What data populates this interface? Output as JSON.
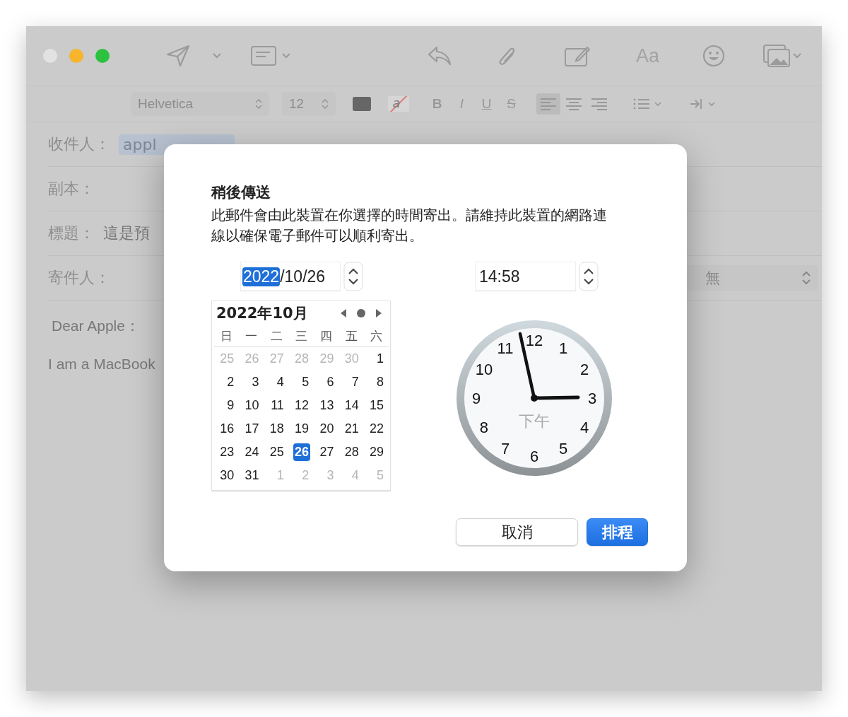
{
  "window": {
    "controls": [
      {
        "color": "#e2e2e2"
      },
      {
        "color": "#f7b52c"
      },
      {
        "color": "#2cc23f"
      }
    ]
  },
  "toolbar": {
    "font_button": "Aa"
  },
  "format_bar": {
    "font": "Helvetica",
    "size": "12",
    "strike_sample": "a",
    "styles": [
      {
        "text": "B",
        "kind": "bold"
      },
      {
        "text": "I",
        "kind": "italic"
      },
      {
        "text": "U",
        "kind": "underline"
      },
      {
        "text": "S",
        "kind": "strike"
      }
    ],
    "align_buttons": [
      {
        "kind": "left",
        "selected": true
      },
      {
        "kind": "center",
        "selected": false
      },
      {
        "kind": "right",
        "selected": false
      }
    ]
  },
  "header_fields": [
    {
      "label": "收件人：",
      "kind": "token",
      "value": "appl"
    },
    {
      "label": "副本：",
      "kind": "text"
    },
    {
      "label": "標題：",
      "kind": "text",
      "value": "這是預"
    },
    {
      "label": "寄件人：",
      "kind": "sender",
      "popup_value": "無"
    }
  ],
  "body": {
    "lines": [
      "Dear Apple：",
      "I am a MacBook"
    ]
  },
  "dialog": {
    "title": "稍後傳送",
    "message": "此郵件會由此裝置在你選擇的時間寄出。請維持此裝置的網路連線以確保電子郵件可以順利寄出。",
    "date_segments": [
      {
        "text": "2022",
        "selected": true
      },
      {
        "text": "/10/26",
        "selected": false
      }
    ],
    "time": "14:58",
    "calendar": {
      "title": "2022年10月",
      "weekdays": [
        "日",
        "一",
        "二",
        "三",
        "四",
        "五",
        "六"
      ],
      "weeks": [
        [
          {
            "day": "25",
            "in_month": false,
            "selected": false
          },
          {
            "day": "26",
            "in_month": false,
            "selected": false
          },
          {
            "day": "27",
            "in_month": false,
            "selected": false
          },
          {
            "day": "28",
            "in_month": false,
            "selected": false
          },
          {
            "day": "29",
            "in_month": false,
            "selected": false
          },
          {
            "day": "30",
            "in_month": false,
            "selected": false
          },
          {
            "day": "1",
            "in_month": true,
            "selected": false
          }
        ],
        [
          {
            "day": "2",
            "in_month": true,
            "selected": false
          },
          {
            "day": "3",
            "in_month": true,
            "selected": false
          },
          {
            "day": "4",
            "in_month": true,
            "selected": false
          },
          {
            "day": "5",
            "in_month": true,
            "selected": false
          },
          {
            "day": "6",
            "in_month": true,
            "selected": false
          },
          {
            "day": "7",
            "in_month": true,
            "selected": false
          },
          {
            "day": "8",
            "in_month": true,
            "selected": false
          }
        ],
        [
          {
            "day": "9",
            "in_month": true,
            "selected": false
          },
          {
            "day": "10",
            "in_month": true,
            "selected": false
          },
          {
            "day": "11",
            "in_month": true,
            "selected": false
          },
          {
            "day": "12",
            "in_month": true,
            "selected": false
          },
          {
            "day": "13",
            "in_month": true,
            "selected": false
          },
          {
            "day": "14",
            "in_month": true,
            "selected": false
          },
          {
            "day": "15",
            "in_month": true,
            "selected": false
          }
        ],
        [
          {
            "day": "16",
            "in_month": true,
            "selected": false
          },
          {
            "day": "17",
            "in_month": true,
            "selected": false
          },
          {
            "day": "18",
            "in_month": true,
            "selected": false
          },
          {
            "day": "19",
            "in_month": true,
            "selected": false
          },
          {
            "day": "20",
            "in_month": true,
            "selected": false
          },
          {
            "day": "21",
            "in_month": true,
            "selected": false
          },
          {
            "day": "22",
            "in_month": true,
            "selected": false
          }
        ],
        [
          {
            "day": "23",
            "in_month": true,
            "selected": false
          },
          {
            "day": "24",
            "in_month": true,
            "selected": false
          },
          {
            "day": "25",
            "in_month": true,
            "selected": false
          },
          {
            "day": "26",
            "in_month": true,
            "selected": true
          },
          {
            "day": "27",
            "in_month": true,
            "selected": false
          },
          {
            "day": "28",
            "in_month": true,
            "selected": false
          },
          {
            "day": "29",
            "in_month": true,
            "selected": false
          }
        ],
        [
          {
            "day": "30",
            "in_month": true,
            "selected": false
          },
          {
            "day": "31",
            "in_month": true,
            "selected": false
          },
          {
            "day": "1",
            "in_month": false,
            "selected": false
          },
          {
            "day": "2",
            "in_month": false,
            "selected": false
          },
          {
            "day": "3",
            "in_month": false,
            "selected": false
          },
          {
            "day": "4",
            "in_month": false,
            "selected": false
          },
          {
            "day": "5",
            "in_month": false,
            "selected": false
          }
        ]
      ]
    },
    "clock": {
      "numbers": [
        "12",
        "1",
        "2",
        "3",
        "4",
        "5",
        "6",
        "7",
        "8",
        "9",
        "10",
        "11"
      ],
      "period": "下午"
    },
    "buttons": [
      {
        "label": "取消",
        "kind": "default"
      },
      {
        "label": "排程",
        "kind": "primary"
      }
    ]
  }
}
